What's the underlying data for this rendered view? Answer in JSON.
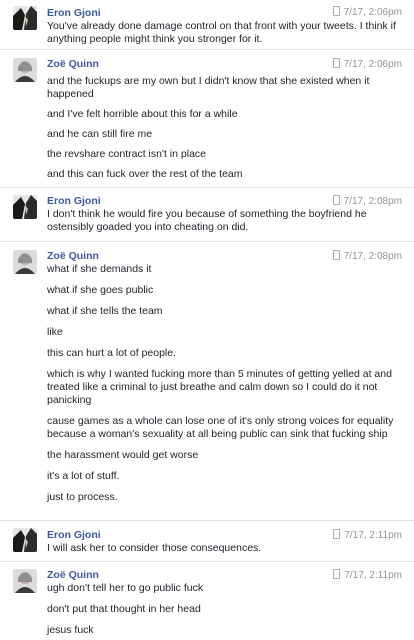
{
  "thread": {
    "groups": [
      {
        "sender": "Eron Gjoni",
        "avatar": "eron-avatar",
        "time": "7/17, 2:06pm",
        "time_icon": "mobile-phone-icon",
        "lines": [
          "You've already done damage control on that front with your tweets. I think if anything people might think you stronger for it."
        ]
      },
      {
        "sender": "Zoë Quinn",
        "avatar": "zoe-avatar",
        "time": "7/17, 2:06pm",
        "time_icon": "mobile-phone-icon",
        "lines": [
          "and the fuckups are my own but I didn't know that she existed when it happened",
          "and I've felt horrible about this for a while",
          "and he can still fire me",
          "the revshare contract isn't in place",
          "and this can fuck over the rest of the team"
        ]
      },
      {
        "sender": "Eron Gjoni",
        "avatar": "eron-avatar",
        "time": "7/17, 2:08pm",
        "time_icon": "mobile-phone-icon",
        "lines": [
          "I don't think he would fire you because of something the boyfriend he ostensibly goaded you into cheating on did."
        ]
      },
      {
        "sender": "Zoë Quinn",
        "avatar": "zoe-avatar",
        "time": "7/17, 2:08pm",
        "time_icon": "mobile-phone-icon",
        "lines": [
          "what if she demands it",
          "what if she goes public",
          "what if she tells the team",
          "like",
          "this can hurt a lot of people.",
          "which is why I wanted fucking more than 5 minutes of getting yelled at and treated like a criminal to just breathe and calm down so I could do it not panicking",
          "cause games as a whole can lose one of it's only strong voices for equality because a woman's sexuality at all being public can sink that fucking ship",
          "the harassment would get worse",
          "it's a lot of stuff.",
          "just to process."
        ]
      },
      {
        "sender": "Eron Gjoni",
        "avatar": "eron-avatar",
        "time": "7/17, 2:11pm",
        "time_icon": "mobile-phone-icon",
        "lines": [
          "I will ask her to consider those consequences."
        ]
      },
      {
        "sender": "Zoë Quinn",
        "avatar": "zoe-avatar",
        "time": "7/17, 2:11pm",
        "time_icon": "mobile-phone-icon",
        "lines": [
          "ugh don't tell her to go public fuck",
          "don't put that thought in her head",
          "jesus fuck"
        ]
      }
    ]
  },
  "colors": {
    "sender": "#3b5998",
    "text": "#1d2129",
    "time": "#90949c",
    "divider": "#e1e4ea"
  }
}
